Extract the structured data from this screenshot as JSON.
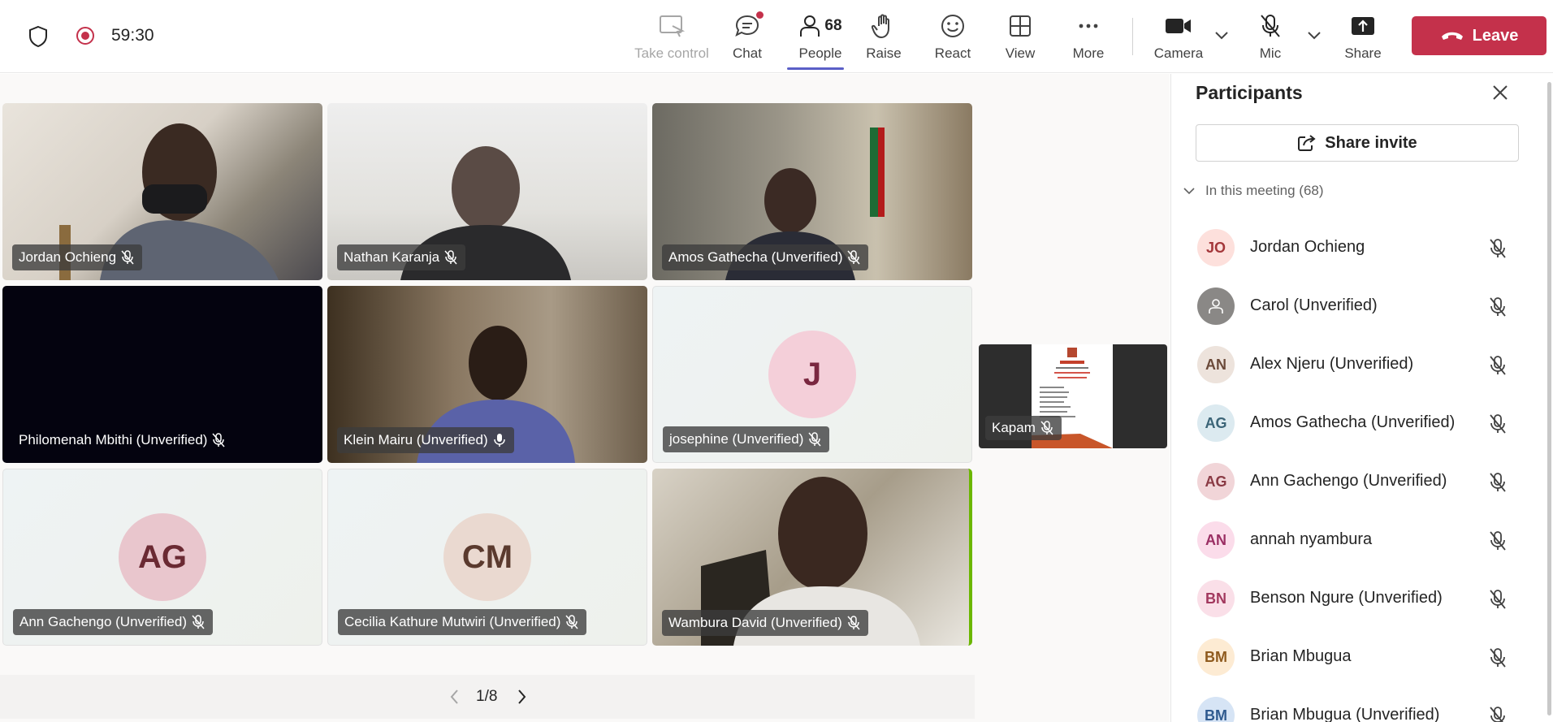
{
  "meeting": {
    "timer": "59:30"
  },
  "toolbar": {
    "take_control": "Take control",
    "chat": "Chat",
    "people": "People",
    "people_count": "68",
    "raise": "Raise",
    "react": "React",
    "view": "View",
    "more": "More",
    "camera": "Camera",
    "mic": "Mic",
    "share": "Share",
    "leave": "Leave"
  },
  "colors": {
    "leave_bg": "#c4314b",
    "accent": "#5b5fc7",
    "speaking": "#6bb700"
  },
  "tiles": [
    {
      "name": "Jordan Ochieng",
      "muted": true,
      "kind": "video"
    },
    {
      "name": "Nathan Karanja",
      "muted": true,
      "kind": "video"
    },
    {
      "name": "Amos Gathecha (Unverified)",
      "muted": true,
      "kind": "video"
    },
    {
      "name": "Philomenah Mbithi (Unverified)",
      "muted": true,
      "kind": "dark"
    },
    {
      "name": "Klein Mairu (Unverified)",
      "muted": false,
      "kind": "video"
    },
    {
      "name": "josephine (Unverified)",
      "muted": true,
      "kind": "avatar",
      "initials": "J"
    },
    {
      "name": "Ann Gachengo (Unverified)",
      "muted": true,
      "kind": "avatar",
      "initials": "AG"
    },
    {
      "name": "Cecilia Kathure Mutwiri (Unverified)",
      "muted": true,
      "kind": "avatar",
      "initials": "CM"
    },
    {
      "name": "Wambura David (Unverified)",
      "muted": true,
      "kind": "video",
      "speaking": true
    }
  ],
  "pinned": {
    "name": "Kapam",
    "muted": true
  },
  "pagination": {
    "page": "1/8"
  },
  "panel": {
    "title": "Participants",
    "share_invite": "Share invite",
    "section_label": "In this meeting (68)",
    "participants": [
      {
        "initials": "JO",
        "name": "Jordan Ochieng",
        "muted": true
      },
      {
        "initials": "",
        "name": "Carol (Unverified)",
        "muted": true,
        "generic": true
      },
      {
        "initials": "AN",
        "name": "Alex Njeru (Unverified)",
        "muted": true
      },
      {
        "initials": "AG",
        "name": "Amos Gathecha (Unverified)",
        "muted": true
      },
      {
        "initials": "AG",
        "name": "Ann Gachengo (Unverified)",
        "muted": true
      },
      {
        "initials": "AN",
        "name": "annah nyambura",
        "muted": true
      },
      {
        "initials": "BN",
        "name": "Benson Ngure (Unverified)",
        "muted": true
      },
      {
        "initials": "BM",
        "name": "Brian Mbugua",
        "muted": true
      },
      {
        "initials": "BM",
        "name": "Brian Mbugua (Unverified)",
        "muted": true
      }
    ]
  }
}
